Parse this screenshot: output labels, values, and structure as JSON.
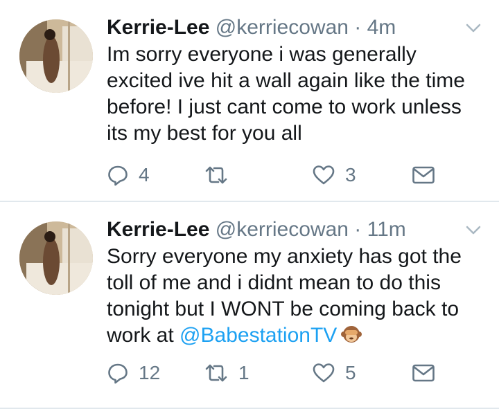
{
  "tweets": [
    {
      "author": {
        "name": "Kerrie-Lee",
        "handle": "@kerriecowan"
      },
      "separator": "·",
      "time": "4m",
      "text": "Im sorry everyone i was generally excited ive hit a wall again like the time before! I just cant come to work unless its my best for you all",
      "mention": "",
      "emoji": "",
      "stats": {
        "replies": "4",
        "retweets": "",
        "likes": "3"
      }
    },
    {
      "author": {
        "name": "Kerrie-Lee",
        "handle": "@kerriecowan"
      },
      "separator": "·",
      "time": "11m",
      "text": "Sorry everyone my anxiety has got the toll of me and i didnt mean to do this tonight but I WONT be coming back to work at",
      "mention": "@BabestationTV",
      "emoji": "see-no-evil-monkey",
      "stats": {
        "replies": "12",
        "retweets": "1",
        "likes": "5"
      }
    }
  ],
  "colors": {
    "text": "#14171a",
    "muted": "#657786",
    "link": "#1da1f2",
    "divider": "#e1e8ed"
  },
  "icons": [
    "reply-icon",
    "retweet-icon",
    "like-icon",
    "direct-message-icon",
    "chevron-down-icon"
  ]
}
